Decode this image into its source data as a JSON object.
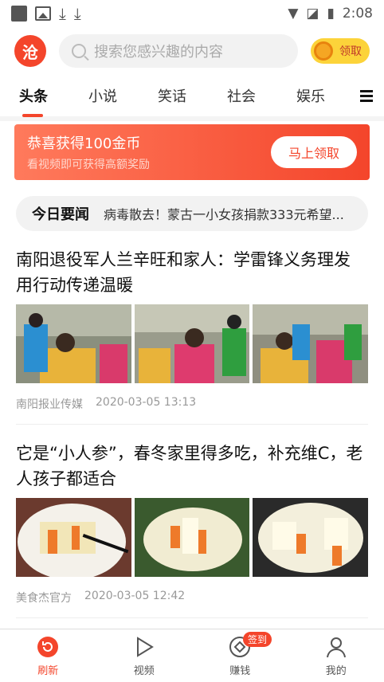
{
  "status": {
    "time": "2:08"
  },
  "header": {
    "logo_char": "沧",
    "search_placeholder": "搜索您感兴趣的内容",
    "coin_label": "领取"
  },
  "tabs": [
    "头条",
    "小说",
    "笑话",
    "社会",
    "娱乐"
  ],
  "banner": {
    "title": "恭喜获得100金币",
    "subtitle": "看视频即可获得高额奖励",
    "button": "马上领取"
  },
  "hot": {
    "label": "今日要闻",
    "text": "病毒散去！蒙古一小女孩捐款333元希望..."
  },
  "articles": [
    {
      "title": "南阳退役军人兰辛旺和家人：学雷锋义务理发 用行动传递温暖",
      "source": "南阳报业传媒",
      "time": "2020-03-05 13:13"
    },
    {
      "title": "它是“小人参”，春冬家里得多吃，补充维C，老人孩子都适合",
      "source": "美食杰官方",
      "time": "2020-03-05 12:42"
    }
  ],
  "nav": [
    {
      "label": "刷新"
    },
    {
      "label": "视频"
    },
    {
      "label": "赚钱",
      "badge": "签到"
    },
    {
      "label": "我的"
    }
  ]
}
